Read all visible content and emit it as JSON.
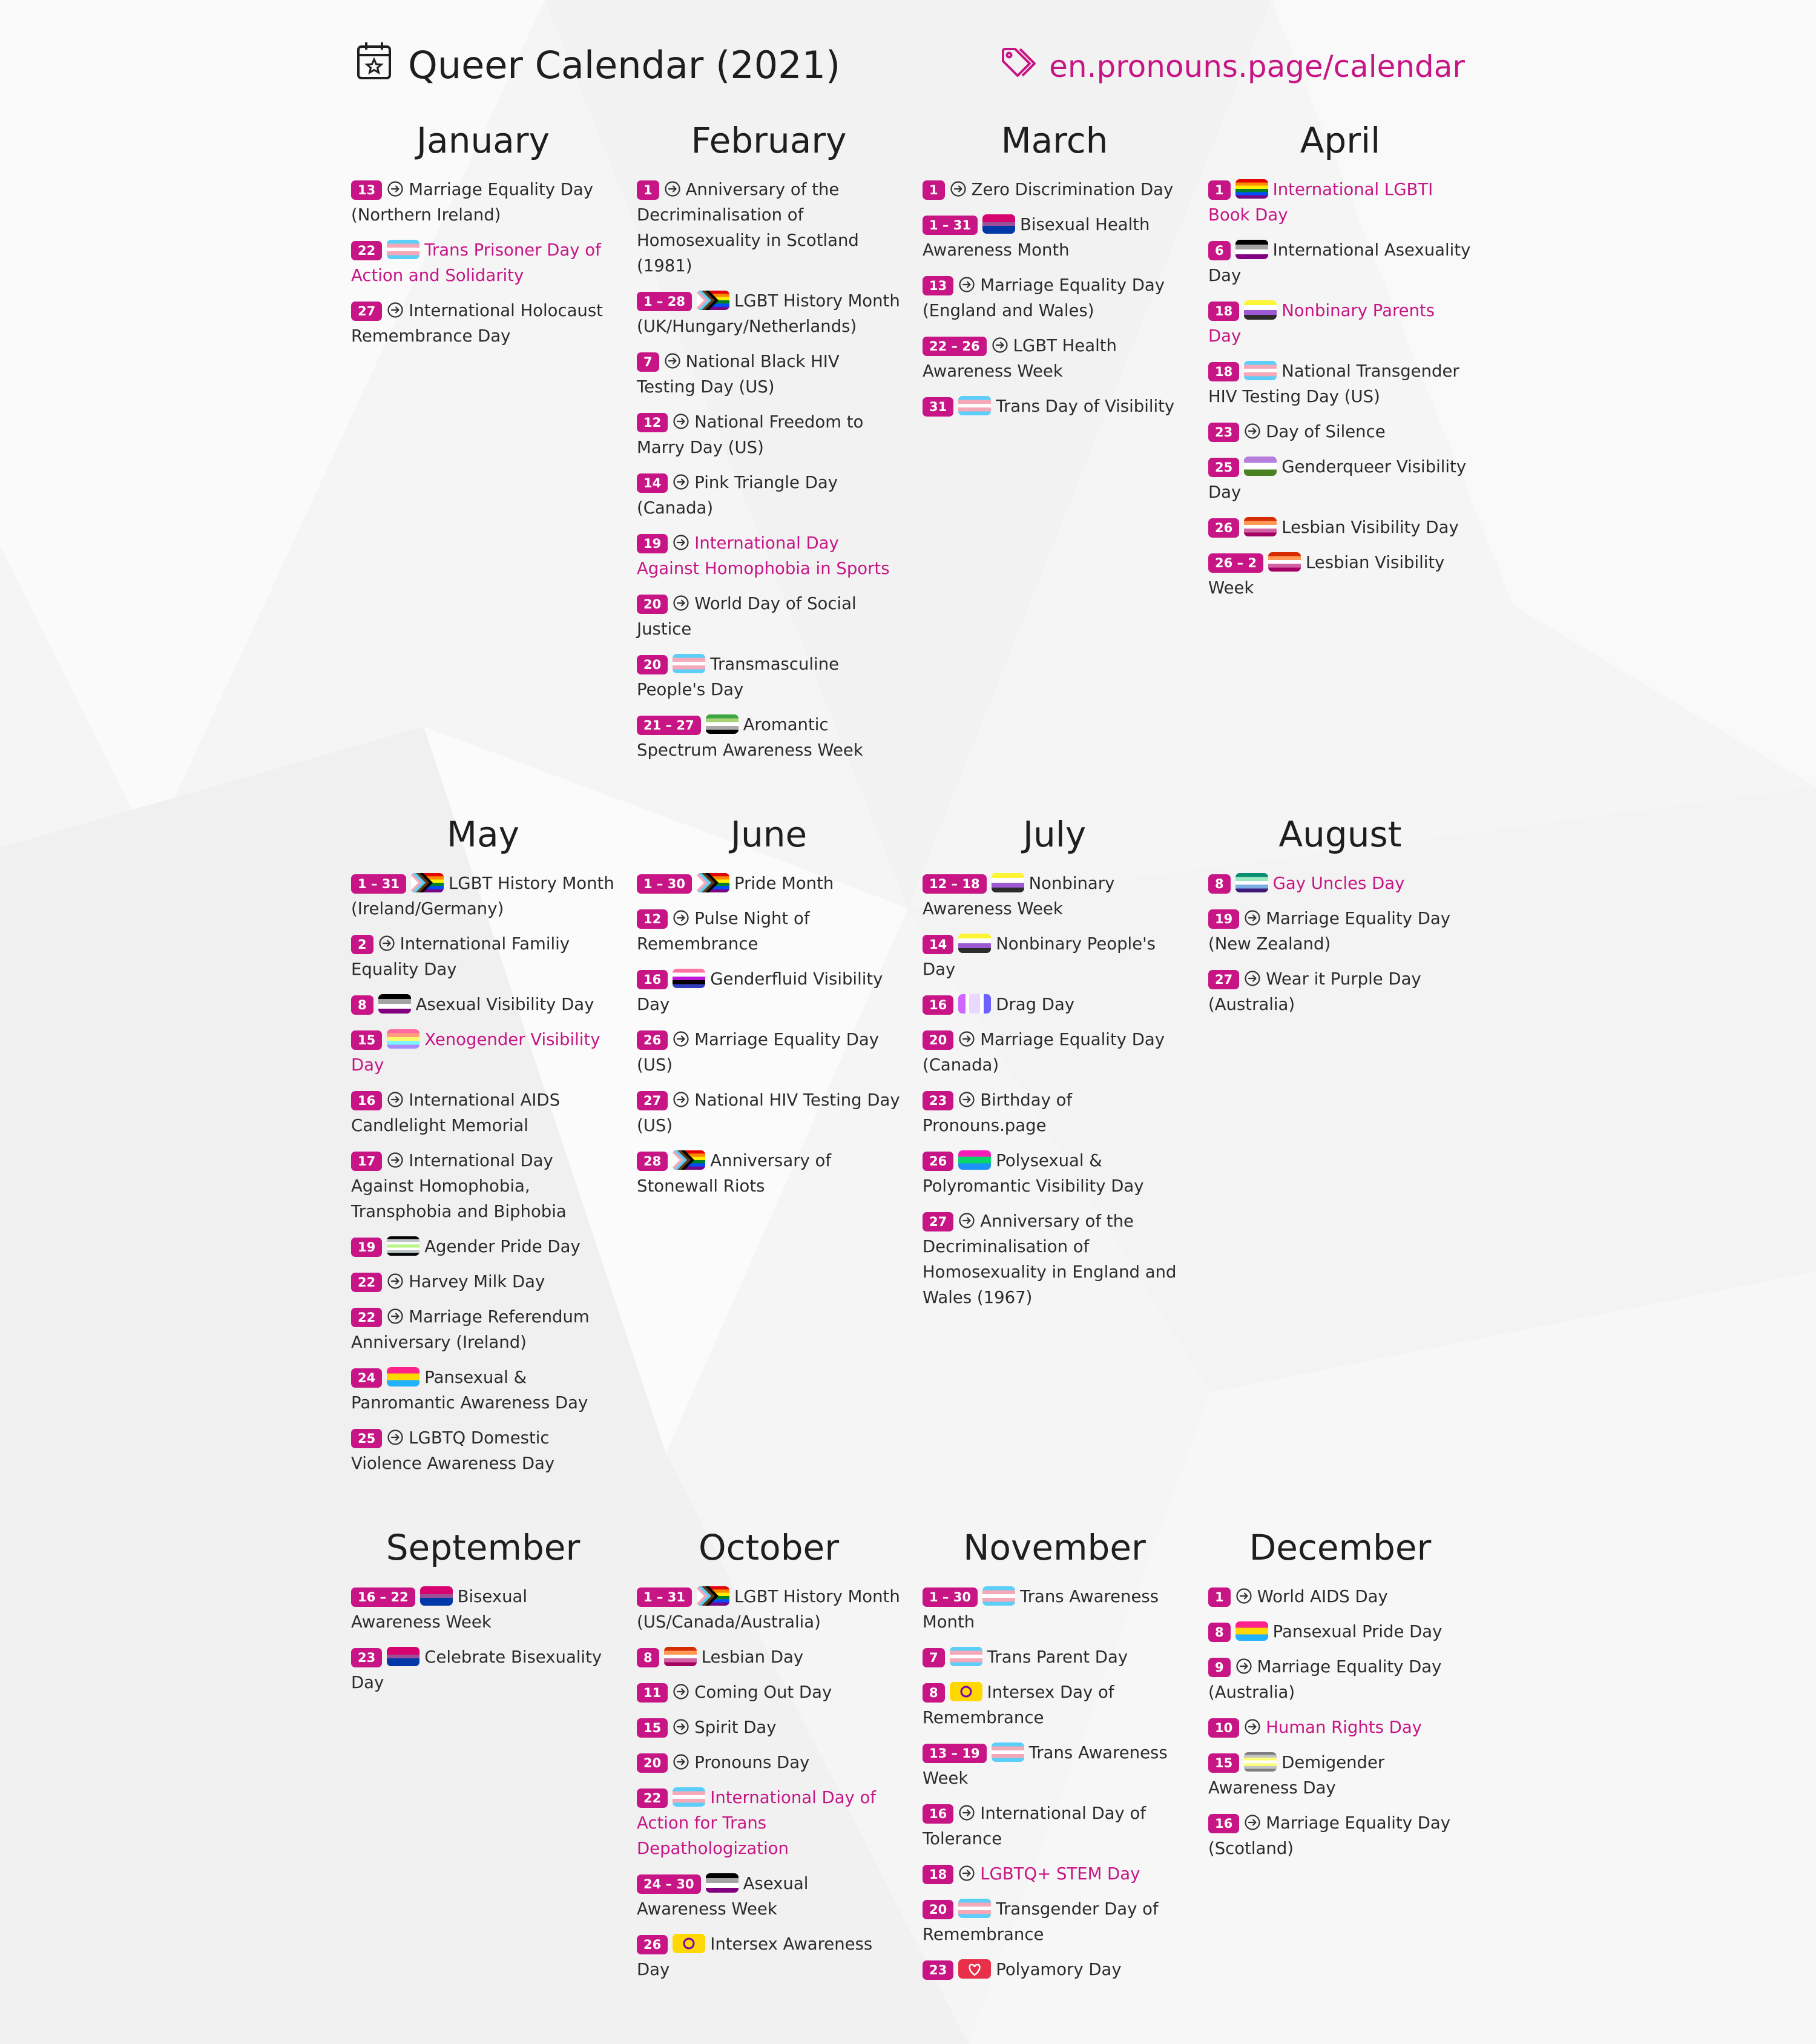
{
  "header": {
    "title": "Queer Calendar (2021)",
    "link": "en.pronouns.page/calendar",
    "accent_color": "#c71585",
    "title_icon": "calendar-star-icon",
    "link_icon": "tags-icon"
  },
  "months": [
    {
      "name": "January",
      "events": [
        {
          "date": "13",
          "icon": "circle-arrow-icon",
          "text": "Marriage Equality Day (Northern Ireland)",
          "highlight": false
        },
        {
          "date": "22",
          "flag": "trans",
          "text": "Trans Prisoner Day of Action and Solidarity",
          "highlight": true
        },
        {
          "date": "27",
          "icon": "circle-arrow-icon",
          "text": "International Holocaust Remembrance Day",
          "highlight": false
        }
      ]
    },
    {
      "name": "February",
      "events": [
        {
          "date": "1",
          "icon": "circle-arrow-icon",
          "text": "Anniversary of the Decriminalisation of Homosexuality in Scotland (1981)",
          "highlight": false
        },
        {
          "date": "1 – 28",
          "flag": "progress",
          "text": "LGBT History Month (UK/Hungary/Netherlands)",
          "highlight": false
        },
        {
          "date": "7",
          "icon": "circle-arrow-icon",
          "text": "National Black HIV Testing Day (US)",
          "highlight": false
        },
        {
          "date": "12",
          "icon": "circle-arrow-icon",
          "text": "National Freedom to Marry Day (US)",
          "highlight": false
        },
        {
          "date": "14",
          "icon": "circle-arrow-icon",
          "text": "Pink Triangle Day (Canada)",
          "highlight": false
        },
        {
          "date": "19",
          "icon": "circle-arrow-icon",
          "text": "International Day Against Homophobia in Sports",
          "highlight": true
        },
        {
          "date": "20",
          "icon": "circle-arrow-icon",
          "text": "World Day of Social Justice",
          "highlight": false
        },
        {
          "date": "20",
          "flag": "trans",
          "text": "Transmasculine People's Day",
          "highlight": false
        },
        {
          "date": "21 – 27",
          "flag": "aromantic",
          "text": "Aromantic Spectrum Awareness Week",
          "highlight": false
        }
      ]
    },
    {
      "name": "March",
      "events": [
        {
          "date": "1",
          "icon": "circle-arrow-icon",
          "text": "Zero Discrimination Day",
          "highlight": false
        },
        {
          "date": "1 – 31",
          "flag": "bisexual",
          "text": "Bisexual Health Awareness Month",
          "highlight": false
        },
        {
          "date": "13",
          "icon": "circle-arrow-icon",
          "text": "Marriage Equality Day (England and Wales)",
          "highlight": false
        },
        {
          "date": "22 – 26",
          "icon": "circle-arrow-icon",
          "text": "LGBT Health Awareness Week",
          "highlight": false
        },
        {
          "date": "31",
          "flag": "trans",
          "text": "Trans Day of Visibility",
          "highlight": false
        }
      ]
    },
    {
      "name": "April",
      "events": [
        {
          "date": "1",
          "flag": "rainbow",
          "text": "International LGBTI Book Day",
          "highlight": true
        },
        {
          "date": "6",
          "flag": "asexual",
          "text": "International Asexuality Day",
          "highlight": false
        },
        {
          "date": "18",
          "flag": "nonbinary",
          "text": "Nonbinary Parents Day",
          "highlight": true
        },
        {
          "date": "18",
          "flag": "trans",
          "text": "National Transgender HIV Testing Day (US)",
          "highlight": false
        },
        {
          "date": "23",
          "icon": "circle-arrow-icon",
          "text": "Day of Silence",
          "highlight": false
        },
        {
          "date": "25",
          "flag": "genderqueer",
          "text": "Genderqueer Visibility Day",
          "highlight": false
        },
        {
          "date": "26",
          "flag": "lesbian",
          "text": "Lesbian Visibility Day",
          "highlight": false
        },
        {
          "date": "26 – 2",
          "flag": "lesbian",
          "text": "Lesbian Visibility Week",
          "highlight": false
        }
      ]
    },
    {
      "name": "May",
      "events": [
        {
          "date": "1 – 31",
          "flag": "progress",
          "text": "LGBT History Month (Ireland/Germany)",
          "highlight": false
        },
        {
          "date": "2",
          "icon": "circle-arrow-icon",
          "text": "International Familiy Equality Day",
          "highlight": false
        },
        {
          "date": "8",
          "flag": "asexual",
          "text": "Asexual Visibility Day",
          "highlight": false
        },
        {
          "date": "15",
          "flag": "xenogender",
          "text": "Xenogender Visibility Day",
          "highlight": true
        },
        {
          "date": "16",
          "icon": "circle-arrow-icon",
          "text": "International AIDS Candlelight Memorial",
          "highlight": false
        },
        {
          "date": "17",
          "icon": "circle-arrow-icon",
          "text": "International Day Against Homophobia, Transphobia and Biphobia",
          "highlight": false
        },
        {
          "date": "19",
          "flag": "agender",
          "text": "Agender Pride Day",
          "highlight": false
        },
        {
          "date": "22",
          "icon": "circle-arrow-icon",
          "text": "Harvey Milk Day",
          "highlight": false
        },
        {
          "date": "22",
          "icon": "circle-arrow-icon",
          "text": "Marriage Referendum Anniversary (Ireland)",
          "highlight": false
        },
        {
          "date": "24",
          "flag": "pansexual",
          "text": "Pansexual & Panromantic Awareness Day",
          "highlight": false
        },
        {
          "date": "25",
          "icon": "circle-arrow-icon",
          "text": "LGBTQ Domestic Violence Awareness Day",
          "highlight": false
        }
      ]
    },
    {
      "name": "June",
      "events": [
        {
          "date": "1 – 30",
          "flag": "progress",
          "text": "Pride Month",
          "highlight": false
        },
        {
          "date": "12",
          "icon": "circle-arrow-icon",
          "text": "Pulse Night of Remembrance",
          "highlight": false
        },
        {
          "date": "16",
          "flag": "genderfluid",
          "text": "Genderfluid Visibility Day",
          "highlight": false
        },
        {
          "date": "26",
          "icon": "circle-arrow-icon",
          "text": "Marriage Equality Day (US)",
          "highlight": false
        },
        {
          "date": "27",
          "icon": "circle-arrow-icon",
          "text": "National HIV Testing Day (US)",
          "highlight": false
        },
        {
          "date": "28",
          "flag": "progress",
          "text": "Anniversary of Stonewall Riots",
          "highlight": false
        }
      ]
    },
    {
      "name": "July",
      "events": [
        {
          "date": "12 – 18",
          "flag": "nonbinary",
          "text": "Nonbinary Awareness Week",
          "highlight": false
        },
        {
          "date": "14",
          "flag": "nonbinary",
          "text": "Nonbinary People's Day",
          "highlight": false
        },
        {
          "date": "16",
          "flag": "drag",
          "text": "Drag Day",
          "highlight": false
        },
        {
          "date": "20",
          "icon": "circle-arrow-icon",
          "text": "Marriage Equality Day (Canada)",
          "highlight": false
        },
        {
          "date": "23",
          "icon": "circle-arrow-icon",
          "text": "Birthday of Pronouns.page",
          "highlight": false
        },
        {
          "date": "26",
          "flag": "polysexual",
          "text": "Polysexual & Polyromantic Visibility Day",
          "highlight": false
        },
        {
          "date": "27",
          "icon": "circle-arrow-icon",
          "text": "Anniversary of the Decriminalisation of Homosexuality in England and Wales (1967)",
          "highlight": false
        }
      ]
    },
    {
      "name": "August",
      "events": [
        {
          "date": "8",
          "flag": "gay-men",
          "text": "Gay Uncles Day",
          "highlight": true
        },
        {
          "date": "19",
          "icon": "circle-arrow-icon",
          "text": "Marriage Equality Day (New Zealand)",
          "highlight": false
        },
        {
          "date": "27",
          "icon": "circle-arrow-icon",
          "text": "Wear it Purple Day (Australia)",
          "highlight": false
        }
      ]
    },
    {
      "name": "September",
      "events": [
        {
          "date": "16 – 22",
          "flag": "bisexual",
          "text": "Bisexual Awareness Week",
          "highlight": false
        },
        {
          "date": "23",
          "flag": "bisexual",
          "text": "Celebrate Bisexuality Day",
          "highlight": false
        }
      ]
    },
    {
      "name": "October",
      "events": [
        {
          "date": "1 – 31",
          "flag": "progress",
          "text": "LGBT History Month (US/Canada/Australia)",
          "highlight": false
        },
        {
          "date": "8",
          "flag": "lesbian",
          "text": "Lesbian Day",
          "highlight": false
        },
        {
          "date": "11",
          "icon": "circle-arrow-icon",
          "text": "Coming Out Day",
          "highlight": false
        },
        {
          "date": "15",
          "icon": "circle-arrow-icon",
          "text": "Spirit Day",
          "highlight": false
        },
        {
          "date": "20",
          "icon": "circle-arrow-icon",
          "text": "Pronouns Day",
          "highlight": false
        },
        {
          "date": "22",
          "flag": "trans",
          "text": "International Day of Action for Trans Depathologization",
          "highlight": true
        },
        {
          "date": "24 – 30",
          "flag": "asexual",
          "text": "Asexual Awareness Week",
          "highlight": false
        },
        {
          "date": "26",
          "flag": "intersex",
          "text": "Intersex Awareness Day",
          "highlight": false
        }
      ]
    },
    {
      "name": "November",
      "events": [
        {
          "date": "1 – 30",
          "flag": "trans",
          "text": "Trans Awareness Month",
          "highlight": false
        },
        {
          "date": "7",
          "flag": "trans",
          "text": "Trans Parent Day",
          "highlight": false
        },
        {
          "date": "8",
          "flag": "intersex",
          "text": "Intersex Day of Remembrance",
          "highlight": false
        },
        {
          "date": "13 – 19",
          "flag": "trans",
          "text": "Trans Awareness Week",
          "highlight": false
        },
        {
          "date": "16",
          "icon": "circle-arrow-icon",
          "text": "International Day of Tolerance",
          "highlight": false
        },
        {
          "date": "18",
          "icon": "circle-arrow-icon",
          "text": "LGBTQ+ STEM Day",
          "highlight": true
        },
        {
          "date": "20",
          "flag": "trans",
          "text": "Transgender Day of Remembrance",
          "highlight": false
        },
        {
          "date": "23",
          "flag": "polyamory",
          "text": "Polyamory Day",
          "highlight": false
        }
      ]
    },
    {
      "name": "December",
      "events": [
        {
          "date": "1",
          "icon": "circle-arrow-icon",
          "text": "World AIDS Day",
          "highlight": false
        },
        {
          "date": "8",
          "flag": "pansexual",
          "text": "Pansexual Pride Day",
          "highlight": false
        },
        {
          "date": "9",
          "icon": "circle-arrow-icon",
          "text": "Marriage Equality Day (Australia)",
          "highlight": false
        },
        {
          "date": "10",
          "icon": "circle-arrow-icon",
          "text": "Human Rights Day",
          "highlight": true
        },
        {
          "date": "15",
          "flag": "demigender",
          "text": "Demigender Awareness Day",
          "highlight": false
        },
        {
          "date": "16",
          "icon": "circle-arrow-icon",
          "text": "Marriage Equality Day (Scotland)",
          "highlight": false
        }
      ]
    }
  ]
}
